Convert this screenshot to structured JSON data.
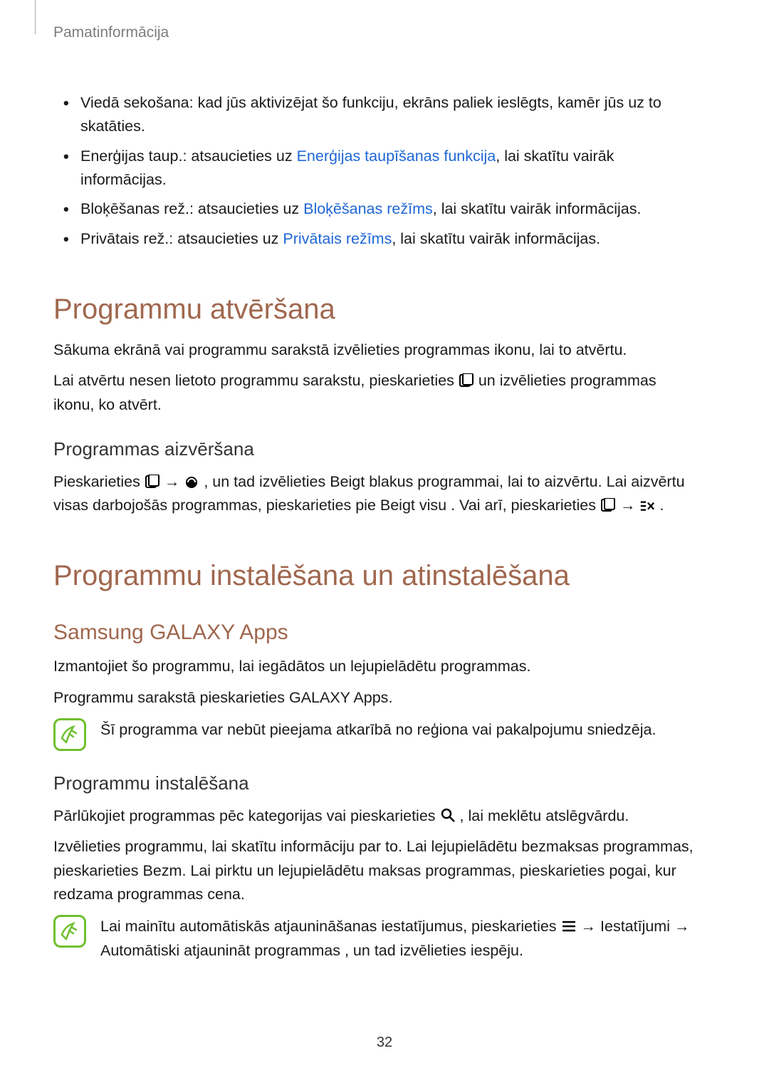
{
  "header": {
    "breadcrumb": "Pamatinformācija"
  },
  "features": {
    "item1": {
      "label": "Viedā sekošana",
      "text": ": kad jūs aktivizējat šo funkciju, ekrāns paliek ieslēgts, kamēr jūs uz to skatāties."
    },
    "item2": {
      "label": "Enerģijas taup.",
      "pre": ": atsaucieties uz ",
      "link": "Enerģijas taupīšanas funkcija",
      "post": ", lai skatītu vairāk informācijas."
    },
    "item3": {
      "label": "Bloķēšanas rež.",
      "pre": ": atsaucieties uz ",
      "link": "Bloķēšanas režīms",
      "post": ", lai skatītu vairāk informācijas."
    },
    "item4": {
      "label": "Privātais rež.",
      "pre": ": atsaucieties uz ",
      "link": "Privātais režīms",
      "post": ", lai skatītu vairāk informācijas."
    }
  },
  "section_open": {
    "title": "Programmu atvēršana",
    "p1": "Sākuma ekrānā vai programmu sarakstā izvēlieties programmas ikonu, lai to atvērtu.",
    "p2_pre": "Lai atvērtu nesen lietoto programmu sarakstu, pieskarieties ",
    "p2_post": " un izvēlieties programmas ikonu, ko atvērt.",
    "close_title": "Programmas aizvēršana",
    "p3_pre": "Pieskarieties ",
    "p3_mid1": " → ",
    "p3_mid2": ", un tad izvēlieties ",
    "p3_beigt": "Beigt",
    "p3_mid3": " blakus programmai, lai to aizvērtu. Lai aizvērtu visas darbojošās programmas, pieskarieties pie ",
    "p3_beigtvisu": "Beigt visu",
    "p3_mid4": ". Vai arī, pieskarieties ",
    "p3_mid5": " → ",
    "p3_end": "."
  },
  "section_install": {
    "title": "Programmu instalēšana un atinstalēšana",
    "galaxy_title": "Samsung GALAXY Apps",
    "p1": "Izmantojiet šo programmu, lai iegādātos un lejupielādētu programmas.",
    "p2_pre": "Programmu sarakstā pieskarieties ",
    "p2_bold": "GALAXY Apps",
    "p2_post": ".",
    "note1": "Šī programma var nebūt pieejama atkarībā no reģiona vai pakalpojumu sniedzēja.",
    "install_title": "Programmu instalēšana",
    "p3_pre": "Pārlūkojiet programmas pēc kategorijas vai pieskarieties ",
    "p3_post": ", lai meklētu atslēgvārdu.",
    "p4_pre": "Izvēlieties programmu, lai skatītu informāciju par to. Lai lejupielādētu bezmaksas programmas, pieskarieties ",
    "p4_bezm": "Bezm.",
    "p4_mid": " Lai pirktu un lejupielādētu maksas programmas, pieskarieties pogai, kur redzama programmas cena.",
    "note2_pre": "Lai mainītu automātiskās atjaunināšanas iestatījumus, pieskarieties ",
    "note2_mid1": " → ",
    "note2_iest": "Iestatījumi",
    "note2_mid2": " → ",
    "note2_auto": "Automātiski atjaunināt programmas",
    "note2_post": ", un tad izvēlieties iespēju."
  },
  "page_number": "32"
}
